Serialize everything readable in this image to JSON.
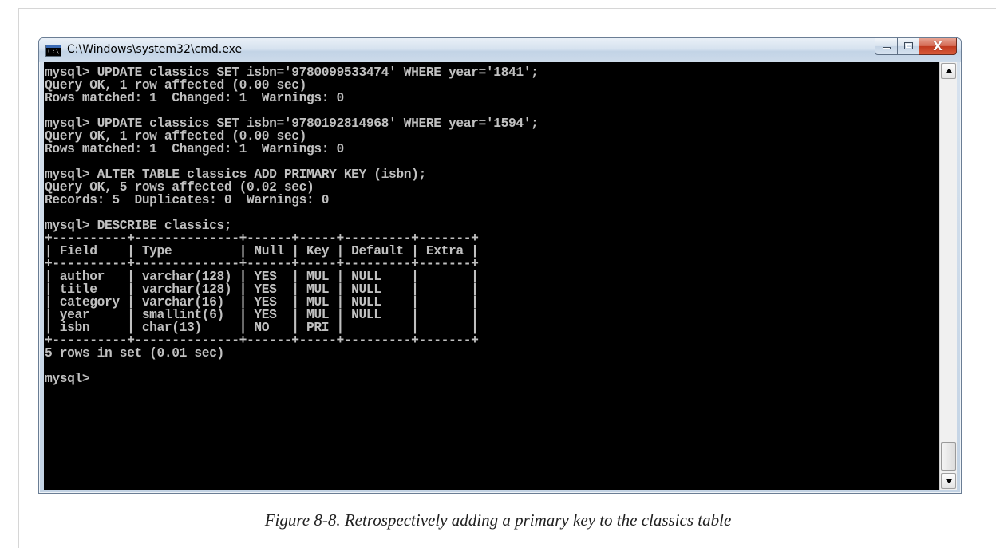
{
  "window": {
    "title": "C:\\Windows\\system32\\cmd.exe",
    "icon": "cmd-console-icon",
    "close_glyph": "X"
  },
  "console": {
    "lines": [
      "mysql> UPDATE classics SET isbn='9780099533474' WHERE year='1841';",
      "Query OK, 1 row affected (0.00 sec)",
      "Rows matched: 1  Changed: 1  Warnings: 0",
      "",
      "mysql> UPDATE classics SET isbn='9780192814968' WHERE year='1594';",
      "Query OK, 1 row affected (0.00 sec)",
      "Rows matched: 1  Changed: 1  Warnings: 0",
      "",
      "mysql> ALTER TABLE classics ADD PRIMARY KEY (isbn);",
      "Query OK, 5 rows affected (0.02 sec)",
      "Records: 5  Duplicates: 0  Warnings: 0",
      "",
      "mysql> DESCRIBE classics;",
      "+----------+--------------+------+-----+---------+-------+",
      "| Field    | Type         | Null | Key | Default | Extra |",
      "+----------+--------------+------+-----+---------+-------+",
      "| author   | varchar(128) | YES  | MUL | NULL    |       |",
      "| title    | varchar(128) | YES  | MUL | NULL    |       |",
      "| category | varchar(16)  | YES  | MUL | NULL    |       |",
      "| year     | smallint(6)  | YES  | MUL | NULL    |       |",
      "| isbn     | char(13)     | NO   | PRI |         |       |",
      "+----------+--------------+------+-----+---------+-------+",
      "5 rows in set (0.01 sec)",
      "",
      "mysql>"
    ],
    "colors": {
      "background": "#000000",
      "text": "#c0c0c0"
    }
  },
  "caption": "Figure 8-8. Retrospectively adding a primary key to the classics table"
}
